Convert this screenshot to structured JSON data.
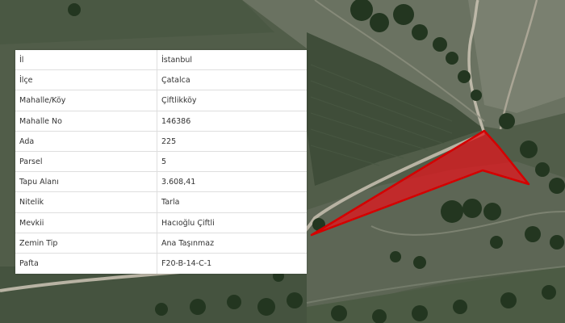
{
  "parcel_info": {
    "rows": [
      {
        "key": "İl",
        "value": "İstanbul"
      },
      {
        "key": "İlçe",
        "value": "Çatalca"
      },
      {
        "key": "Mahalle/Köy",
        "value": "Çiftlikköy"
      },
      {
        "key": "Mahalle No",
        "value": "146386"
      },
      {
        "key": "Ada",
        "value": "225"
      },
      {
        "key": "Parsel",
        "value": "5"
      },
      {
        "key": "Tapu Alanı",
        "value": "3.608,41"
      },
      {
        "key": "Nitelik",
        "value": "Tarla"
      },
      {
        "key": "Mevkii",
        "value": "Hacıoğlu Çiftli"
      },
      {
        "key": "Zemin Tip",
        "value": "Ana Taşınmaz"
      },
      {
        "key": "Pafta",
        "value": "F20-B-14-C-1"
      }
    ]
  },
  "map": {
    "parcel_fill": "#e8141c",
    "parcel_stroke": "#d40000",
    "imagery": "satellite"
  }
}
